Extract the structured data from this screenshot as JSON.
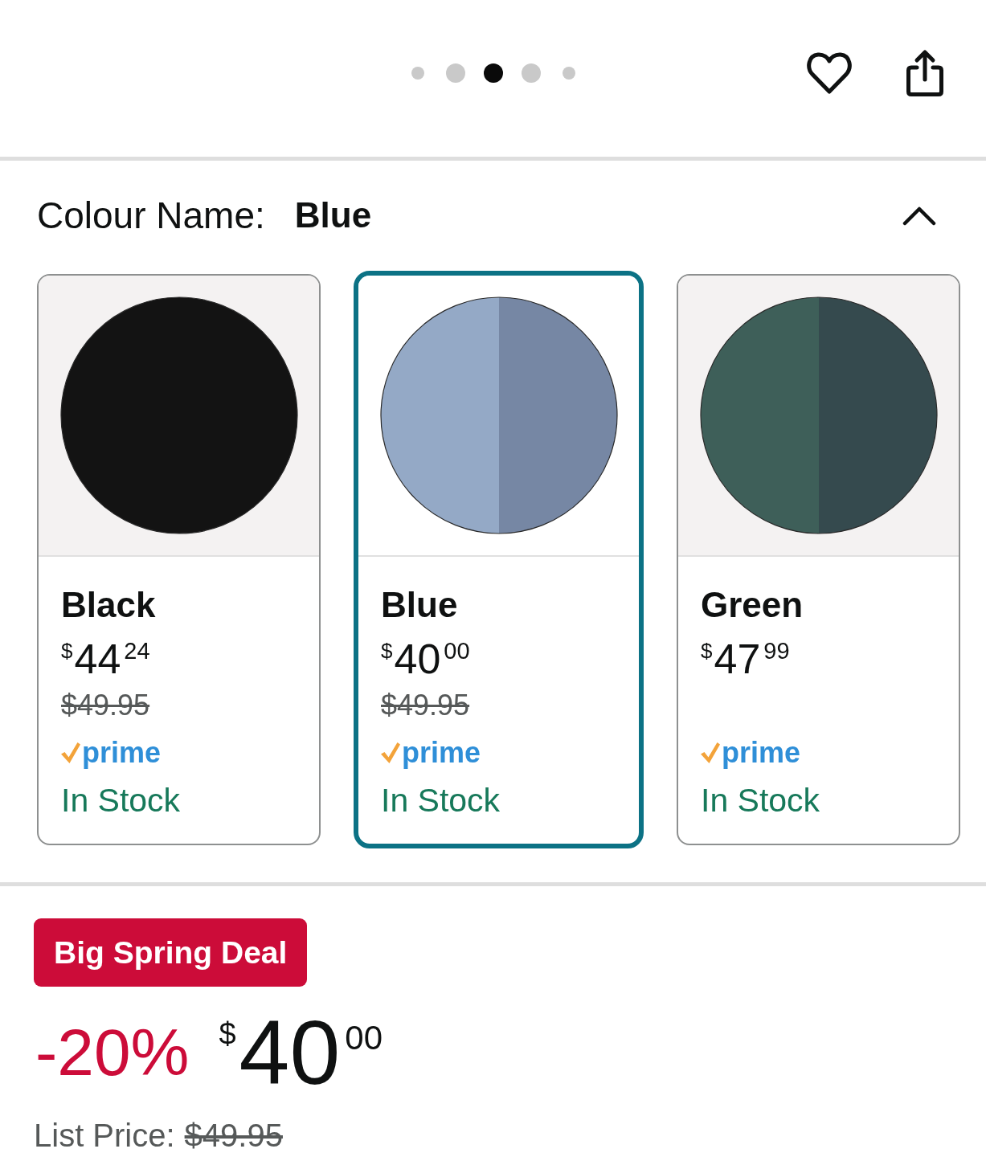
{
  "carousel": {
    "dots": [
      {
        "kind": "small",
        "selected": false
      },
      {
        "kind": "large",
        "selected": false
      },
      {
        "kind": "large",
        "selected": true
      },
      {
        "kind": "large",
        "selected": false
      },
      {
        "kind": "small",
        "selected": false
      }
    ]
  },
  "colour_selector": {
    "label": "Colour Name:",
    "value": "Blue",
    "expanded": true,
    "options": [
      {
        "name": "Black",
        "swatch": [
          {
            "color": "#131313"
          }
        ],
        "price": {
          "symbol": "$",
          "whole": "44",
          "fraction": "24"
        },
        "was_price": "$49.95",
        "badge": "prime",
        "availability": "In Stock",
        "selected": false
      },
      {
        "name": "Blue",
        "swatch": [
          {
            "color": "#94a9c6"
          },
          {
            "color": "#7687a4"
          }
        ],
        "price": {
          "symbol": "$",
          "whole": "40",
          "fraction": "00"
        },
        "was_price": "$49.95",
        "badge": "prime",
        "availability": "In Stock",
        "selected": true
      },
      {
        "name": "Green",
        "swatch": [
          {
            "color": "#3e5f59"
          },
          {
            "color": "#354a4e"
          }
        ],
        "price": {
          "symbol": "$",
          "whole": "47",
          "fraction": "99"
        },
        "badge": "prime",
        "availability": "In Stock",
        "selected": false
      }
    ]
  },
  "deal": {
    "badge": "Big Spring Deal",
    "discount": "-20%",
    "price": {
      "symbol": "$",
      "whole": "40",
      "fraction": "00"
    },
    "list_price_label": "List Price:",
    "list_price": "$49.95"
  }
}
